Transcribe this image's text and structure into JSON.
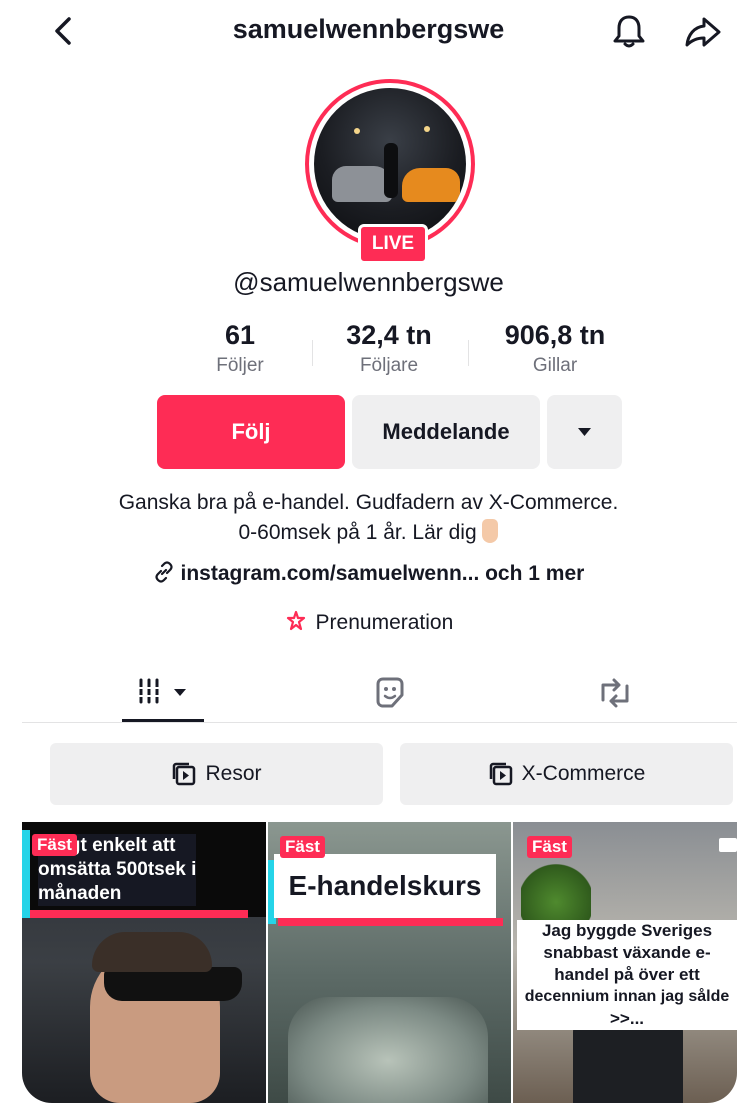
{
  "header": {
    "username": "samuelwennbergswe"
  },
  "profile": {
    "live_badge": "LIVE",
    "handle": "@samuelwennbergswe",
    "stats": [
      {
        "value": "61",
        "label": "Följer"
      },
      {
        "value": "32,4 tn",
        "label": "Följare"
      },
      {
        "value": "906,8 tn",
        "label": "Gillar"
      }
    ],
    "follow_label": "Följ",
    "message_label": "Meddelande",
    "bio_line1": "Ganska bra på e-handel. Gudfadern av X-Commerce.",
    "bio_line2": "0-60msek på 1 år. Lär dig",
    "link_text": "instagram.com/samuelwenn... och 1 mer",
    "subscription_label": "Prenumeration"
  },
  "playlists": [
    {
      "label": "Resor"
    },
    {
      "label": "X-Commerce"
    }
  ],
  "videos": [
    {
      "pinned": "Fäst",
      "caption_lines": [
        "digt enkelt att",
        "omsätta 500tsek i",
        "månaden"
      ]
    },
    {
      "pinned": "Fäst",
      "caption": "E-handelskurs"
    },
    {
      "pinned": "Fäst",
      "caption_lines": [
        "Jag byggde Sveriges",
        "snabbast växande e-",
        "handel på över ett",
        "decennium innan jag sålde",
        ">>..."
      ]
    }
  ],
  "colors": {
    "accent": "#fe2c55",
    "text": "#161823",
    "secondary": "#6e707a",
    "button_gray": "#efeff0"
  }
}
